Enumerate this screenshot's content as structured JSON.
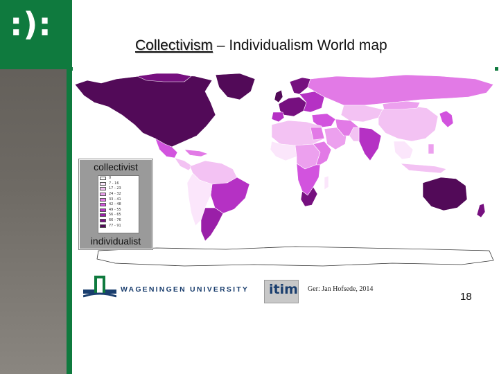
{
  "slide": {
    "logo_text": ":):",
    "title_key": "Collectivism",
    "title_rest": " – Individualism World map",
    "page_number": "18",
    "source": "Ger: Jan Hofsede, 2014"
  },
  "legend": {
    "top_label": "collectivist",
    "bottom_label": "individualist",
    "classes": [
      {
        "label": "0",
        "color": "#ffffff"
      },
      {
        "label": "7 - 16",
        "color": "#fbe6fb"
      },
      {
        "label": "17 - 23",
        "color": "#f3c2f3"
      },
      {
        "label": "24 - 32",
        "color": "#eca0ee"
      },
      {
        "label": "33 - 41",
        "color": "#e27ae6"
      },
      {
        "label": "42 - 48",
        "color": "#d253de"
      },
      {
        "label": "49 - 55",
        "color": "#b531c4"
      },
      {
        "label": "56 - 65",
        "color": "#9a1fa8"
      },
      {
        "label": "66 - 76",
        "color": "#76107f"
      },
      {
        "label": "77 - 91",
        "color": "#520a58"
      }
    ]
  },
  "footer": {
    "university": "WAGENINGEN UNIVERSITY",
    "partner_logo": "itim"
  },
  "colors": {
    "brand_green": "#0f7a3e",
    "sidebar_gray": "#6a6660"
  }
}
